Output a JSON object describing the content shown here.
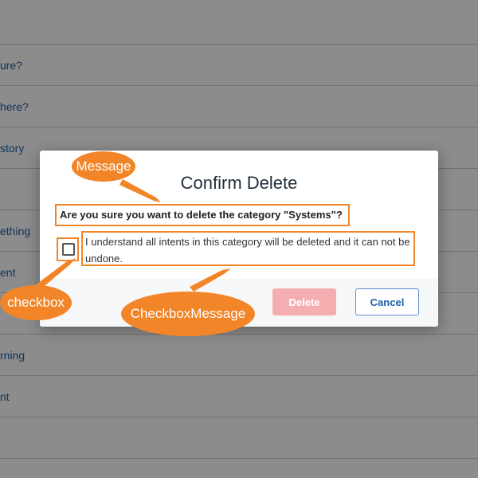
{
  "background_list": {
    "rows": [
      {
        "label": ""
      },
      {
        "label": "ure?"
      },
      {
        "label": "here?"
      },
      {
        "label": "story"
      },
      {
        "label": ""
      },
      {
        "label": "ething"
      },
      {
        "label": "ent"
      },
      {
        "label": ""
      },
      {
        "label": "rning"
      },
      {
        "label": "nt"
      },
      {
        "label": ""
      }
    ]
  },
  "dialog": {
    "title": "Confirm Delete",
    "message": "Are you sure you want to delete the category \"Systems\"?",
    "checkbox_message": "I understand all intents in this category will be deleted and it can not be undone.",
    "checkbox_checked": false,
    "buttons": {
      "delete": "Delete",
      "cancel": "Cancel"
    }
  },
  "annotations": {
    "message_label": "Message",
    "checkbox_label": "checkbox",
    "checkbox_message_label": "CheckboxMessage",
    "color": "#f28528"
  }
}
